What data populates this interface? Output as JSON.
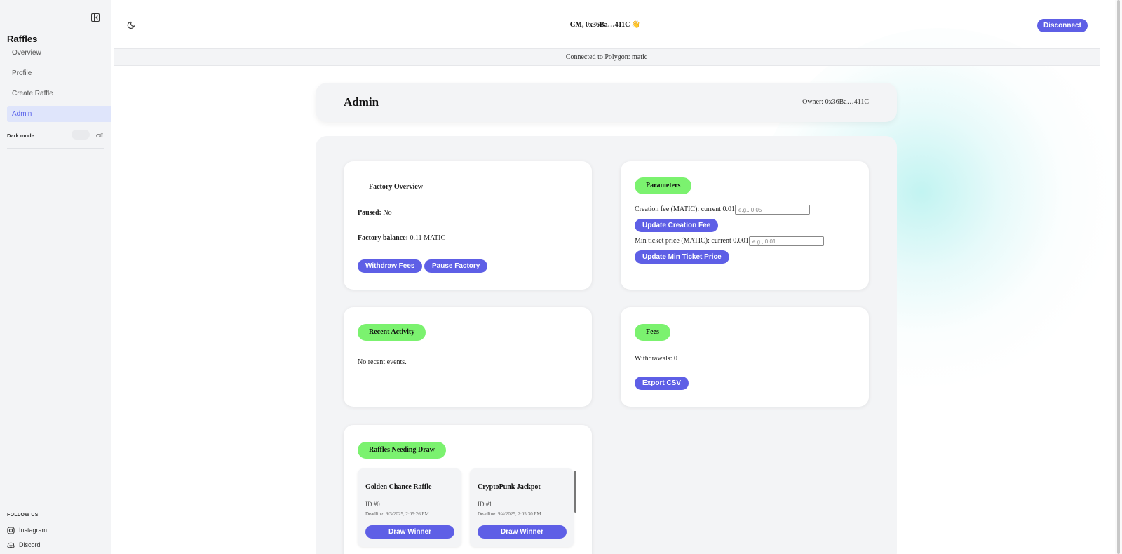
{
  "sidebar": {
    "brand": "Raffles",
    "items": [
      {
        "label": "Overview"
      },
      {
        "label": "Profile"
      },
      {
        "label": "Create Raffle"
      },
      {
        "label": "Admin"
      }
    ],
    "dark_mode_label": "Dark mode",
    "dark_mode_state": "Off",
    "follow_label": "FOLLOW US",
    "socials": [
      {
        "label": "Instagram",
        "icon": "instagram-icon"
      },
      {
        "label": "Discord",
        "icon": "discord-icon"
      }
    ]
  },
  "header": {
    "greeting": "GM, 0x36Ba…411C 👋",
    "disconnect_label": "Disconnect",
    "connection": "Connected to Polygon: matic"
  },
  "admin": {
    "title": "Admin",
    "owner": "Owner: 0x36Ba…411C"
  },
  "factory": {
    "title": "Factory Overview",
    "paused_label": "Paused:",
    "paused_value": "No",
    "balance_label": "Factory balance:",
    "balance_value": "0.11 MATIC",
    "withdraw_label": "Withdraw Fees",
    "pause_label": "Pause Factory"
  },
  "parameters": {
    "title": "Parameters",
    "creation_fee_label": "Creation fee (MATIC): current 0.01",
    "creation_fee_placeholder": "e.g., 0.05",
    "update_creation_label": "Update Creation Fee",
    "min_ticket_label": "Min ticket price (MATIC): current 0.001",
    "min_ticket_placeholder": "e.g., 0.01",
    "update_min_label": "Update Min Ticket Price"
  },
  "activity": {
    "title": "Recent Activity",
    "empty": "No recent events."
  },
  "fees": {
    "title": "Fees",
    "withdrawals": "Withdrawals: 0",
    "export_label": "Export CSV"
  },
  "draw": {
    "title": "Raffles Needing Draw",
    "raffles": [
      {
        "name": "Golden Chance Raffle",
        "id": "ID #0",
        "deadline": "Deadline: 9/3/2025, 2:05:26 PM",
        "action": "Draw Winner"
      },
      {
        "name": "CryptoPunk Jackpot",
        "id": "ID #1",
        "deadline": "Deadline: 9/4/2025, 2:05:30 PM",
        "action": "Draw Winner"
      }
    ]
  },
  "colors": {
    "accent": "#5e5fe6",
    "pill_green": "#7bf26f",
    "panel_bg": "#f3f4f6"
  }
}
